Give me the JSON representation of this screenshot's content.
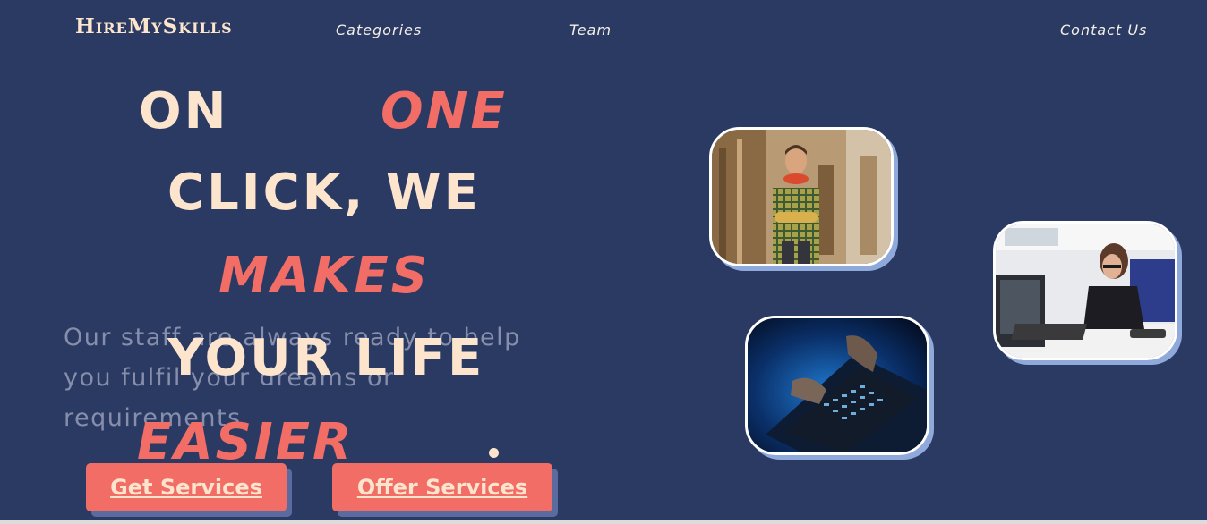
{
  "nav": {
    "logo": "HireMySkills",
    "links": [
      "Categories",
      "Team",
      "Contact Us"
    ]
  },
  "hero": {
    "words": [
      "ON",
      "ONE",
      "CLICK, WE",
      "MAKES",
      "YOUR LIFE",
      "EASIER"
    ],
    "tagline": "Our staff are always ready to help you fulfil your dreams or requirements."
  },
  "buttons": {
    "get_services": "Get Services",
    "offer_services": "Offer Services"
  },
  "colors": {
    "background": "#2a3a63",
    "cream": "#fde5cd",
    "accent": "#f26d66"
  },
  "images": [
    "carpenter-photo",
    "laptop-typing-photo",
    "office-worker-photo"
  ]
}
